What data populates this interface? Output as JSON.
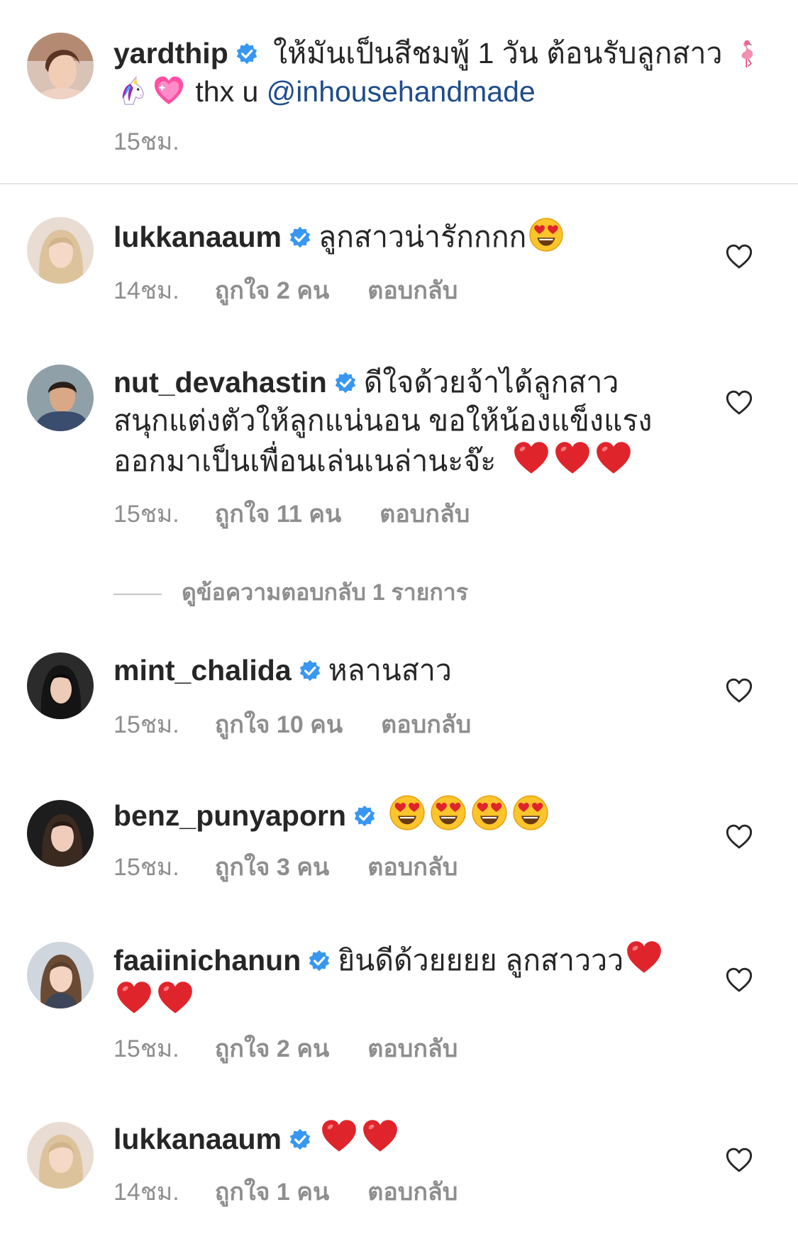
{
  "caption": {
    "username": "yardthip",
    "text": " ให้มันเป็นสีชมพู้ 1 วัน ต้อนรับลูกสาว",
    "text2": " thx u ",
    "mention": "@inhousehandmade",
    "time": "15ชม.",
    "emojis": [
      "flamingo-emoji",
      "unicorn-emoji",
      "sparkling-heart-emoji"
    ]
  },
  "view_replies": "ดูข้อความตอบกลับ 1 รายการ",
  "comments": [
    {
      "username": "lukkanaaum",
      "text": "ลูกสาวน่ารักกกก",
      "time": "14ชม.",
      "likes": "ถูกใจ 2 คน",
      "reply": "ตอบกลับ",
      "emojis": [
        "heart-eyes-emoji"
      ]
    },
    {
      "username": "nut_devahastin",
      "text_line1": "ดีใจด้วยจ้าได้ลูกสาว",
      "text_line2": "สนุกแต่งตัวให้ลูกแน่นอน ขอให้น้องแข็งแรง",
      "text_line3": "ออกมาเป็นเพื่อนเล่นเนล่านะจ๊ะ",
      "time": "15ชม.",
      "likes": "ถูกใจ 11 คน",
      "reply": "ตอบกลับ",
      "emojis": [
        "red-heart-emoji",
        "red-heart-emoji",
        "red-heart-emoji"
      ]
    },
    {
      "username": "mint_chalida",
      "text": "หลานสาว",
      "time": "15ชม.",
      "likes": "ถูกใจ 10 คน",
      "reply": "ตอบกลับ"
    },
    {
      "username": "benz_punyaporn",
      "text": "",
      "time": "15ชม.",
      "likes": "ถูกใจ 3 คน",
      "reply": "ตอบกลับ",
      "emojis": [
        "heart-eyes-emoji",
        "heart-eyes-emoji",
        "heart-eyes-emoji",
        "heart-eyes-emoji"
      ]
    },
    {
      "username": "faaiinichanun",
      "text": "ยินดีด้วยยยย ลูกสาววว",
      "time": "15ชม.",
      "likes": "ถูกใจ 2 คน",
      "reply": "ตอบกลับ",
      "emojis": [
        "red-heart-emoji",
        "red-heart-emoji",
        "red-heart-emoji"
      ]
    },
    {
      "username": "lukkanaaum",
      "text": "",
      "time": "14ชม.",
      "likes": "ถูกใจ 1 คน",
      "reply": "ตอบกลับ",
      "emojis": [
        "red-heart-emoji",
        "red-heart-emoji"
      ]
    }
  ],
  "colors": {
    "verified": "#3897f0",
    "meta": "#8e8e8e",
    "mention": "#1e4d8c",
    "text": "#262626"
  }
}
